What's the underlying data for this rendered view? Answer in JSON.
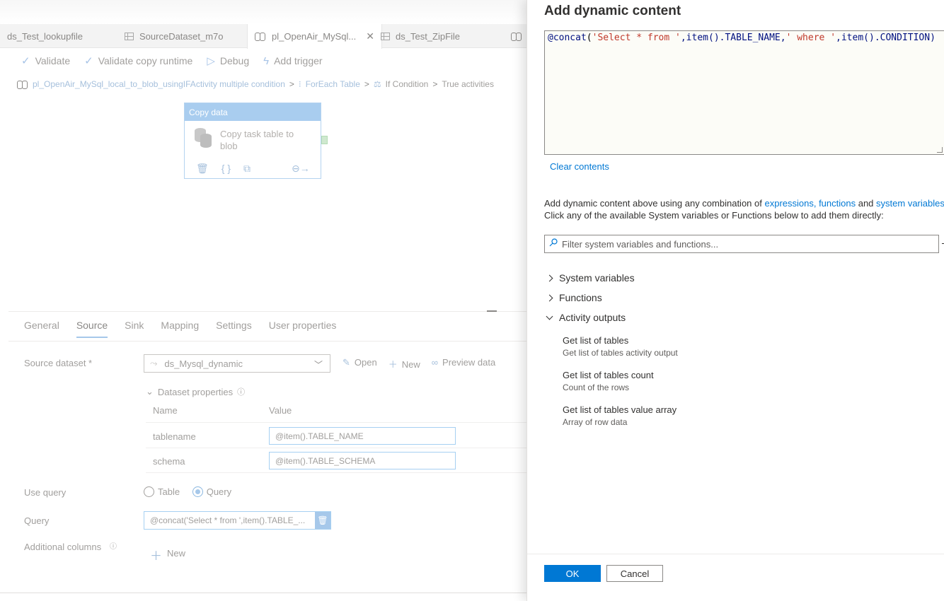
{
  "tabs": [
    {
      "label": "ds_Test_lookupfile",
      "icon": "dataset-icon"
    },
    {
      "label": "SourceDataset_m7o",
      "icon": "dataset-icon"
    },
    {
      "label": "pl_OpenAir_MySql...",
      "icon": "pipeline-icon",
      "active": true
    },
    {
      "label": "ds_Test_ZipFile",
      "icon": "dataset-icon"
    }
  ],
  "toolbar": {
    "validate": "Validate",
    "validate_copy_runtime": "Validate copy runtime",
    "debug": "Debug",
    "add_trigger": "Add trigger"
  },
  "breadcrumb": {
    "pipeline": "pl_OpenAir_MySql_local_to_blob_usingIFActivity multiple condition",
    "foreach": "ForEach Table",
    "ifcond": "If Condition",
    "current": "True activities"
  },
  "activity": {
    "header": "Copy data",
    "name": "Copy task table to blob"
  },
  "property_tabs": [
    "General",
    "Source",
    "Sink",
    "Mapping",
    "Settings",
    "User properties"
  ],
  "source": {
    "dataset_label": "Source dataset *",
    "dataset_value": "ds_Mysql_dynamic",
    "open": "Open",
    "new": "New",
    "preview": "Preview data",
    "dataset_properties": "Dataset properties",
    "col_name": "Name",
    "col_value": "Value",
    "props": [
      {
        "name": "tablename",
        "value": "@item().TABLE_NAME"
      },
      {
        "name": "schema",
        "value": "@item().TABLE_SCHEMA"
      }
    ],
    "use_query_label": "Use query",
    "option_table": "Table",
    "option_query": "Query",
    "query_label": "Query",
    "query_value": "@concat('Select * from ',item().TABLE_...",
    "additional_columns_label": "Additional columns",
    "additional_new": "New"
  },
  "dialog": {
    "title": "Add dynamic content",
    "expr": {
      "at_concat": "@concat",
      "open": "(",
      "s1": "'Select * from '",
      "mid1": ",item().TABLE_NAME,",
      "s2": "' where '",
      "mid2": ",item().CONDITION)"
    },
    "clear": "Clear contents",
    "help_prefix": "Add dynamic content above using any combination of ",
    "help_link1": "expressions, functions",
    "help_and": " and ",
    "help_link2": "system variables",
    "help_line2": "Click any of the available System variables or Functions below to add them directly:",
    "filter_placeholder": "Filter system variables and functions...",
    "sections": {
      "system_variables": "System variables",
      "functions": "Functions",
      "activity_outputs": "Activity outputs"
    },
    "outputs": [
      {
        "name": "Get list of tables",
        "desc": "Get list of tables activity output"
      },
      {
        "name": "Get list of tables count",
        "desc": "Count of the rows"
      },
      {
        "name": "Get list of tables value array",
        "desc": "Array of row data"
      }
    ],
    "ok": "OK",
    "cancel": "Cancel"
  },
  "colors": {
    "accent": "#0078d4",
    "string_literal": "#c0392b",
    "identifier": "#001080"
  }
}
